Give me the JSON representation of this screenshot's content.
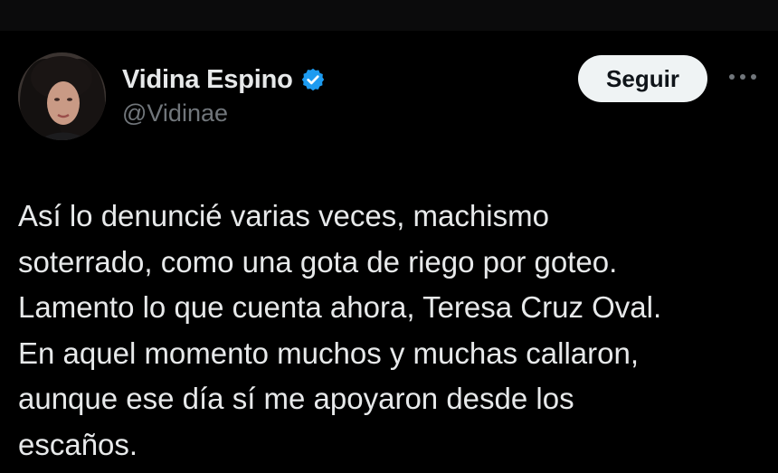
{
  "author": {
    "display_name": "Vidina Espino",
    "handle": "@Vidinae",
    "verified": true,
    "verified_icon": "verified-badge-icon",
    "verified_color": "#1d9bf0"
  },
  "actions": {
    "follow_label": "Seguir",
    "more_icon": "more-horizontal-icon"
  },
  "tweet": {
    "text": "Así lo denuncié varias veces, machismo\nsoterrado, como una gota de riego por goteo.\nLamento lo que cuenta ahora, Teresa Cruz Oval.\nEn aquel momento muchos y muchas callaron,\naunque ese día sí me apoyaron desde los\nescaños."
  },
  "colors": {
    "background": "#000000",
    "text_primary": "#e7e9ea",
    "text_secondary": "#71767b",
    "button_bg": "#eff3f4",
    "button_text": "#0f1419"
  }
}
